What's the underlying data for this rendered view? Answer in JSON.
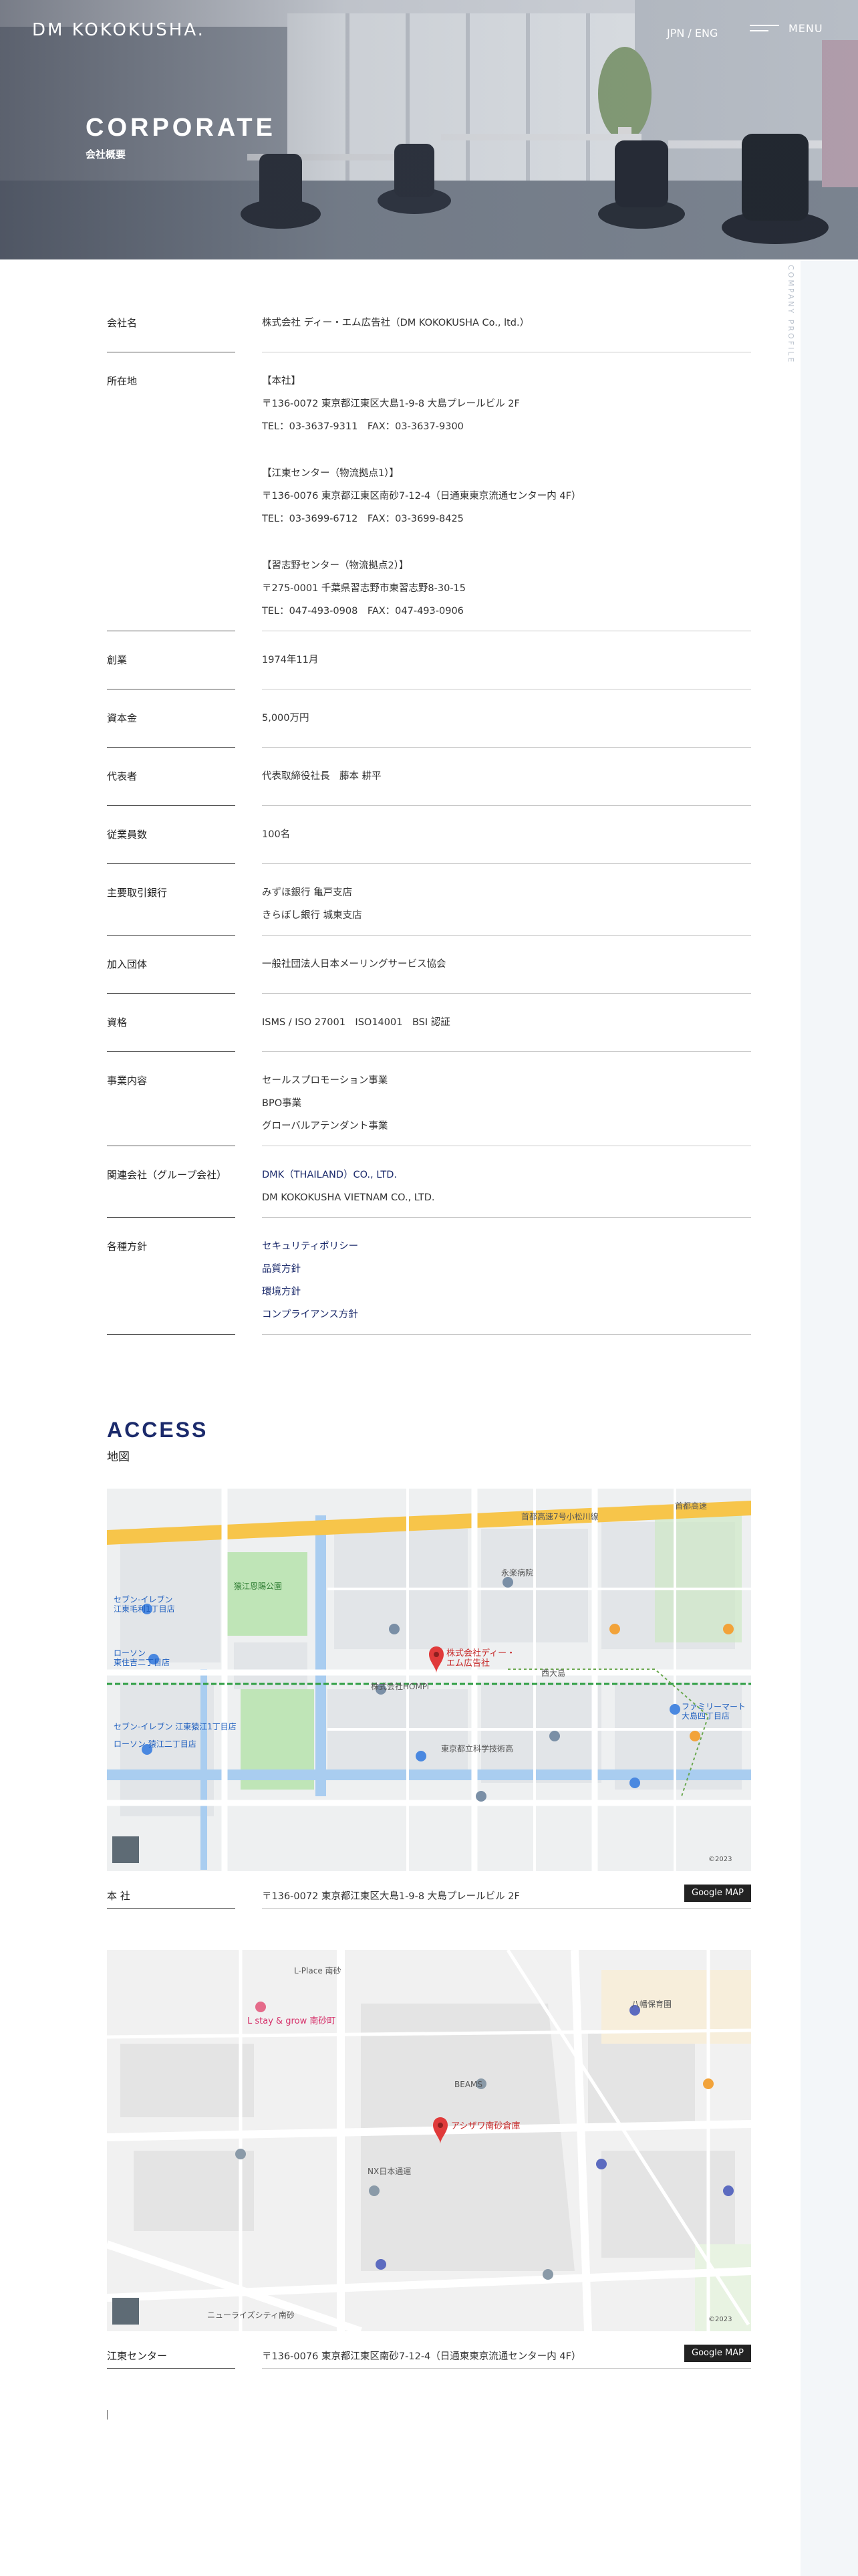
{
  "header": {
    "logo": "DM KOKOKUSHA.",
    "lang": "JPN / ENG",
    "menu_label": "MENU"
  },
  "hero": {
    "title": "CORPORATE",
    "subtitle": "会社概要"
  },
  "side_label": "COMPANY PROFILE",
  "profile": {
    "company_name": {
      "label": "会社名",
      "value": "株式会社 ディー・エム広告社（DM KOKOKUSHA Co., ltd.）"
    },
    "location": {
      "label": "所在地",
      "hq_title": "【本社】",
      "hq_addr": "〒136-0072 東京都江東区大島1-9-8 大島プレールビル 2F",
      "hq_tel": "TEL：03-3637-9311　FAX：03-3637-9300",
      "koto_title": "【江東センター（物流拠点1）】",
      "koto_addr": "〒136-0076 東京都江東区南砂7-12-4（日通東東京流通センター内 4F）",
      "koto_tel": "TEL：03-3699-6712　FAX：03-3699-8425",
      "narashino_title": "【習志野センター（物流拠点2）】",
      "narashino_addr": "〒275-0001 千葉県習志野市東習志野8-30-15",
      "narashino_tel": "TEL：047-493-0908　FAX：047-493-0906"
    },
    "founded": {
      "label": "創業",
      "value": "1974年11月"
    },
    "capital": {
      "label": "資本金",
      "value": "5,000万円"
    },
    "representative": {
      "label": "代表者",
      "value": "代表取締役社長　藤本 耕平"
    },
    "employees": {
      "label": "従業員数",
      "value": "100名"
    },
    "banks": {
      "label": "主要取引銀行",
      "items": [
        "みずほ銀行 亀戸支店",
        "きらぼし銀行 城東支店"
      ]
    },
    "association": {
      "label": "加入団体",
      "value": "一般社団法人日本メーリングサービス協会"
    },
    "certification": {
      "label": "資格",
      "value": "ISMS / ISO 27001　ISO14001　BSI 認証"
    },
    "business": {
      "label": "事業内容",
      "items": [
        "セールスプロモーション事業",
        "BPO事業",
        "グローバルアテンダント事業"
      ]
    },
    "group": {
      "label": "関連会社（グループ会社）",
      "link": "DMK（THAILAND）CO., LTD.",
      "text": "DM KOKOKUSHA VIETNAM CO., LTD."
    },
    "policies": {
      "label": "各種方針",
      "items": [
        "セキュリティポリシー",
        "品質方針",
        "環境方針",
        "コンプライアンス方針"
      ]
    }
  },
  "access": {
    "title": "ACCESS",
    "subtitle": "地図",
    "map1": {
      "labels": {
        "highway": "首都高速7号小松川線",
        "highway2": "首都高速",
        "ojima": "大島",
        "park1": "猿江恩賜公園",
        "store1": "セブン-イレブン 江東毛利1丁目店",
        "store2": "ローソン 東住吉二丁目店",
        "mark_company": "株式会社ディー・エム広告社",
        "hompi": "株式会社HOMPi",
        "nishi_ojima": "西大島",
        "lawson2": "ローソン 猿江二丁目店",
        "seven2": "セブン-イレブン 江東猿江1丁目店",
        "family": "ファミリーマート 大島四丁目店",
        "hospital": "永楽病院",
        "school": "東京都立科学技術高",
        "copyright": "©2023"
      },
      "loc_label": "本 社",
      "loc_addr": "〒136-0072 東京都江東区大島1-9-8 大島プレールビル 2F",
      "button": "Google MAP"
    },
    "map2": {
      "labels": {
        "lstay": "L stay & grow 南砂町",
        "mark_asaz": "アシザワ南砂倉庫",
        "beams": "BEAMS",
        "nx": "NX日本通運",
        "lplace": "L-Place 南砂",
        "hachiman": "八幡保育園",
        "city": "ニューライズシティ南砂",
        "copyright": "©2023"
      },
      "loc_label": "江東センター",
      "loc_addr": "〒136-0076 東京都江東区南砂7-12-4（日通東東京流通センター内 4F）",
      "button": "Google MAP"
    }
  },
  "colors": {
    "accent": "#1b2a6b",
    "link": "#1b2a6b",
    "map_road": "#f7c54a",
    "map_water": "#a9cdf0",
    "map_park": "#b9e3b2",
    "pin": "#e03a3a"
  }
}
